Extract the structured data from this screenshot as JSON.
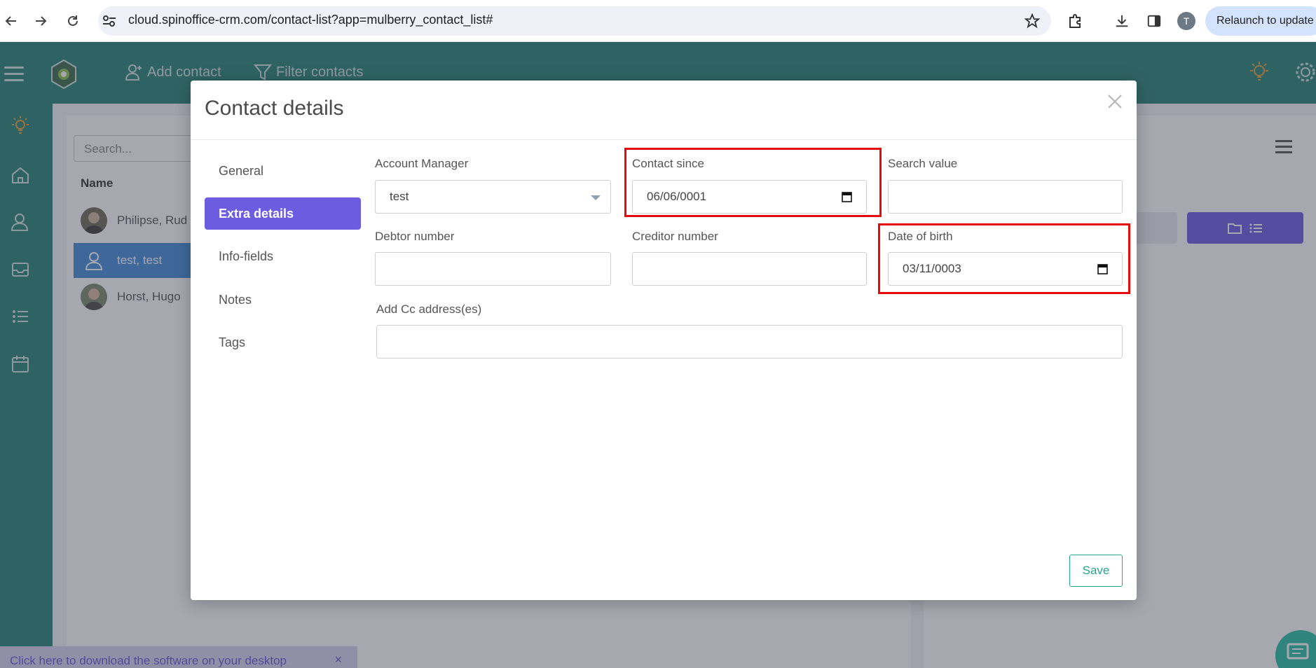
{
  "browser": {
    "url": "cloud.spinoffice-crm.com/contact-list?app=mulberry_contact_list#",
    "profile_initial": "T",
    "relaunch_label": "Relaunch to update"
  },
  "header": {
    "add_contact_label": "Add contact",
    "filter_contacts_label": "Filter contacts"
  },
  "list": {
    "search_placeholder": "Search...",
    "column_name": "Name",
    "contacts": [
      {
        "name": "Philipse, Rud"
      },
      {
        "name": "test, test"
      },
      {
        "name": "Horst, Hugo"
      }
    ]
  },
  "download_bar": {
    "text": "Click here to download the software on your desktop",
    "close": "×"
  },
  "modal": {
    "title": "Contact details",
    "tabs": [
      {
        "label": "General"
      },
      {
        "label": "Extra details"
      },
      {
        "label": "Info-fields"
      },
      {
        "label": "Notes"
      },
      {
        "label": "Tags"
      }
    ],
    "fields": {
      "account_manager": {
        "label": "Account Manager",
        "value": "test"
      },
      "contact_since": {
        "label": "Contact since",
        "value": "06/06/0001"
      },
      "search_value": {
        "label": "Search value",
        "value": ""
      },
      "debtor_number": {
        "label": "Debtor number",
        "value": ""
      },
      "creditor_number": {
        "label": "Creditor number",
        "value": ""
      },
      "date_of_birth": {
        "label": "Date of birth",
        "value": "03/11/0003"
      },
      "add_cc": {
        "label": "Add Cc address(es)",
        "value": ""
      }
    },
    "save_label": "Save"
  },
  "colors": {
    "brand_teal": "#268473",
    "accent_purple": "#6b5ce0",
    "highlight_red": "#e30b0b",
    "save_green": "#27a58e"
  },
  "icons": [
    "back-icon",
    "forward-icon",
    "reload-icon",
    "site-settings-icon",
    "star-icon",
    "extensions-icon",
    "download-icon",
    "side-panel-icon",
    "hamburger-icon",
    "app-logo",
    "add-contact-icon",
    "filter-icon",
    "lightbulb-icon",
    "settings-gear-icon",
    "home-icon",
    "contacts-icon",
    "inbox-icon",
    "list-icon",
    "calendar-icon",
    "close-icon",
    "calendar-picker-icon",
    "chat-icon"
  ]
}
